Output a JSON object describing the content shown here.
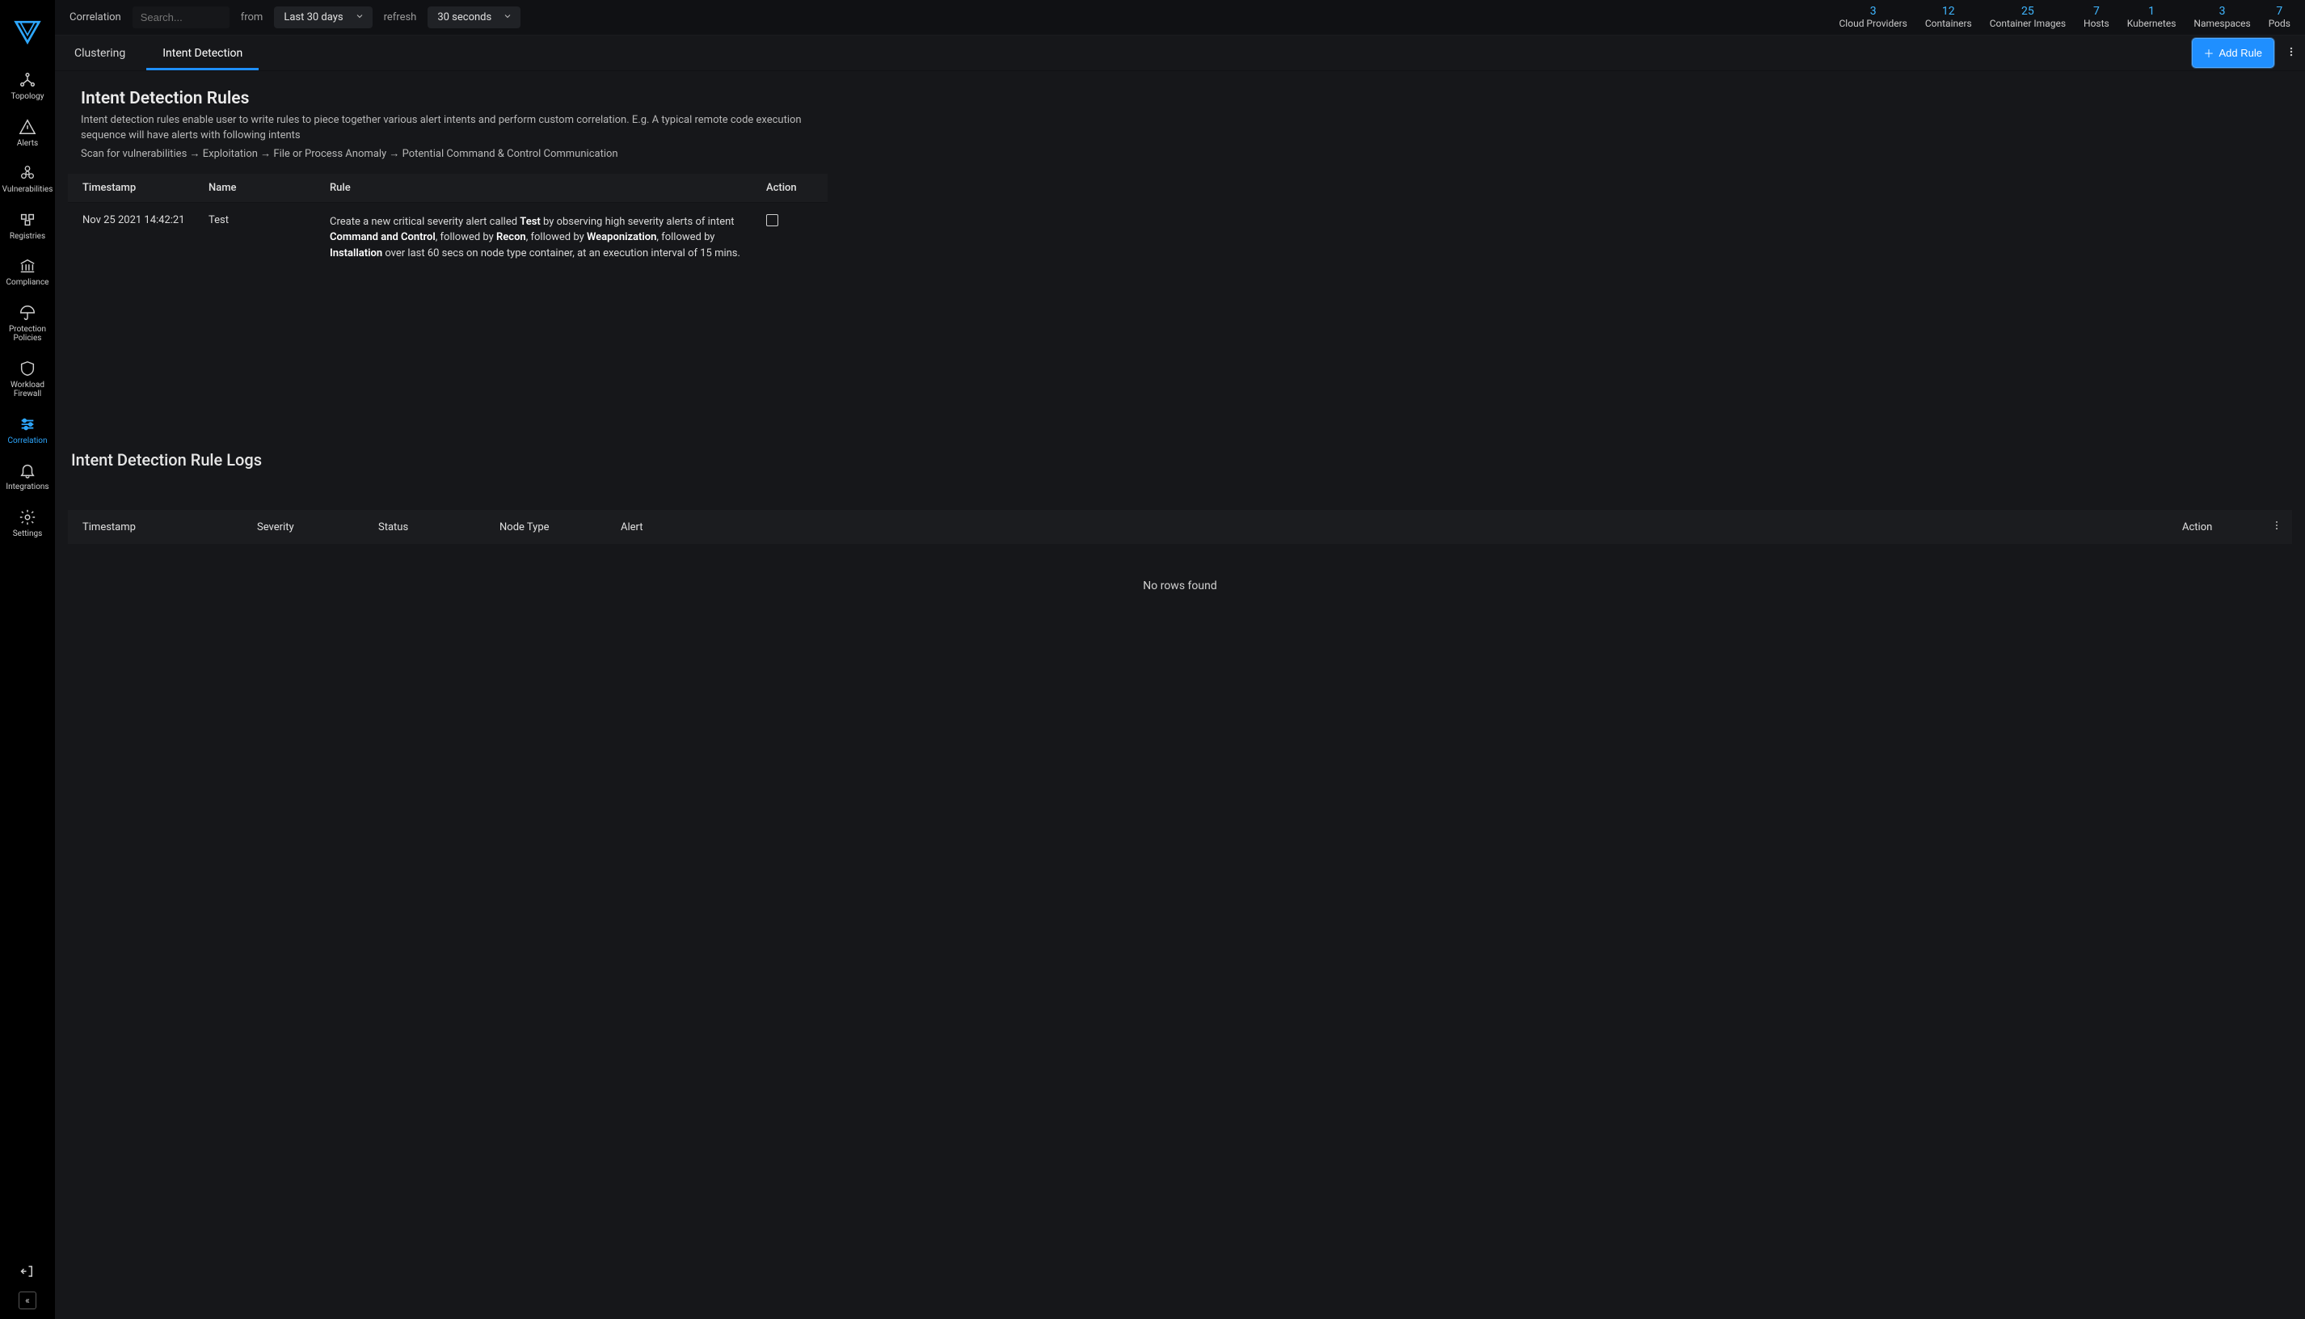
{
  "brand": "Deepfence",
  "sidebar": {
    "items": [
      {
        "label": "Topology",
        "icon": "topology-icon"
      },
      {
        "label": "Alerts",
        "icon": "alert-triangle-icon"
      },
      {
        "label": "Vulnerabilities",
        "icon": "biohazard-icon"
      },
      {
        "label": "Registries",
        "icon": "registry-icon"
      },
      {
        "label": "Compliance",
        "icon": "bank-icon"
      },
      {
        "label": "Protection Policies",
        "icon": "umbrella-icon"
      },
      {
        "label": "Workload Firewall",
        "icon": "shield-icon"
      },
      {
        "label": "Correlation",
        "icon": "sliders-icon",
        "active": true
      },
      {
        "label": "Integrations",
        "icon": "bell-icon"
      },
      {
        "label": "Settings",
        "icon": "gear-icon"
      }
    ]
  },
  "topbar": {
    "crumb": "Correlation",
    "search_placeholder": "Search...",
    "from_label": "from",
    "range_value": "Last 30 days",
    "refresh_label": "refresh",
    "refresh_value": "30 seconds"
  },
  "stats": [
    {
      "value": "3",
      "label": "Cloud Providers"
    },
    {
      "value": "12",
      "label": "Containers"
    },
    {
      "value": "25",
      "label": "Container Images"
    },
    {
      "value": "7",
      "label": "Hosts"
    },
    {
      "value": "1",
      "label": "Kubernetes"
    },
    {
      "value": "3",
      "label": "Namespaces"
    },
    {
      "value": "7",
      "label": "Pods"
    }
  ],
  "tabs": {
    "clustering": "Clustering",
    "intent": "Intent Detection",
    "active": "intent",
    "add_rule": "Add Rule"
  },
  "rules_section": {
    "title": "Intent Detection Rules",
    "desc1": "Intent detection rules enable user to write rules to piece together various alert intents and perform custom correlation. E.g. A typical remote code execution sequence will have alerts with following intents",
    "desc2": "Scan for vulnerabilities → Exploitation → File or Process Anomaly → Potential Command & Control Communication",
    "columns": {
      "timestamp": "Timestamp",
      "name": "Name",
      "rule": "Rule",
      "action": "Action"
    }
  },
  "rules_rows": [
    {
      "timestamp": "Nov 25 2021 14:42:21",
      "name": "Test",
      "rule": {
        "t1": "Create a new critical severity alert called ",
        "b1": "Test",
        "t2": " by observing high severity alerts of intent ",
        "b2": "Command and Control",
        "t3": ", followed by ",
        "b3": "Recon",
        "t4": ", followed by ",
        "b4": "Weaponization",
        "t5": ", followed by ",
        "b5": "Installation",
        "t6": " over last 60 secs on node type container, at an execution interval of 15 mins."
      }
    }
  ],
  "logs_section": {
    "title": "Intent Detection Rule Logs",
    "columns": {
      "timestamp": "Timestamp",
      "severity": "Severity",
      "status": "Status",
      "node_type": "Node Type",
      "alert": "Alert",
      "action": "Action"
    },
    "empty": "No rows found"
  }
}
